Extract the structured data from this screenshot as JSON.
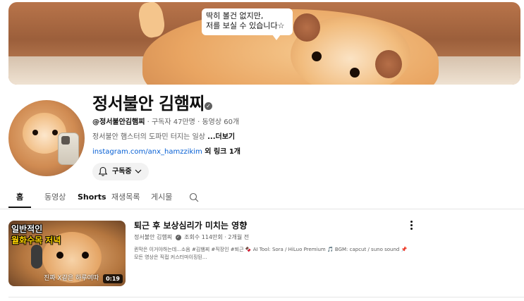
{
  "banner": {
    "bubble_line1": "딱히 볼건 없지만,",
    "bubble_line2": "저를 보실 수 있습니다☆"
  },
  "channel": {
    "name": "정서불안 김햄찌",
    "handle": "@정서불안김햄찌",
    "subscribers": "구독자 47만명",
    "videos": "동영상 60개",
    "separator": "·",
    "description": "정서불안 햄스터의 도파민 터지는 일상 ",
    "more": "...더보기",
    "link_url": "instagram.com/anx_hamzzikim",
    "link_extra": " 외 링크 1개",
    "subscribe_label": "구독중"
  },
  "tabs": [
    {
      "label": "홈"
    },
    {
      "label": "동영상"
    },
    {
      "label": "Shorts"
    },
    {
      "label": "재생목록"
    },
    {
      "label": "게시물"
    }
  ],
  "video": {
    "thumb_line1": "일반적인",
    "thumb_line2": "월화수목 저녁",
    "thumb_sub": "진짜 X같은 하루여따",
    "duration": "0:19",
    "title": "퇴근 후 보상심리가 미치는 영향",
    "channel": "정서불안 김햄찌",
    "views": "조회수 114만회",
    "age": "2개월 전",
    "desc_line1": "퀸막은 이거야하는데...소음 #김햄찌 #직장인 #퇴근 🍫 AI Tool: Sora / HiLuo Premium 🎵 BGM: capcut / suno sound 📌",
    "desc_line2": "모든 영상은 직접 커스터마이징된..."
  },
  "icons": {
    "verified": "verified-check-icon",
    "bell": "bell-icon",
    "chevron": "chevron-down-icon",
    "search": "search-icon",
    "more": "more-vertical-icon"
  },
  "colors": {
    "link": "#065fd4",
    "text": "#0f0f0f",
    "secondary": "#606060",
    "button_bg": "#f2f2f2"
  }
}
